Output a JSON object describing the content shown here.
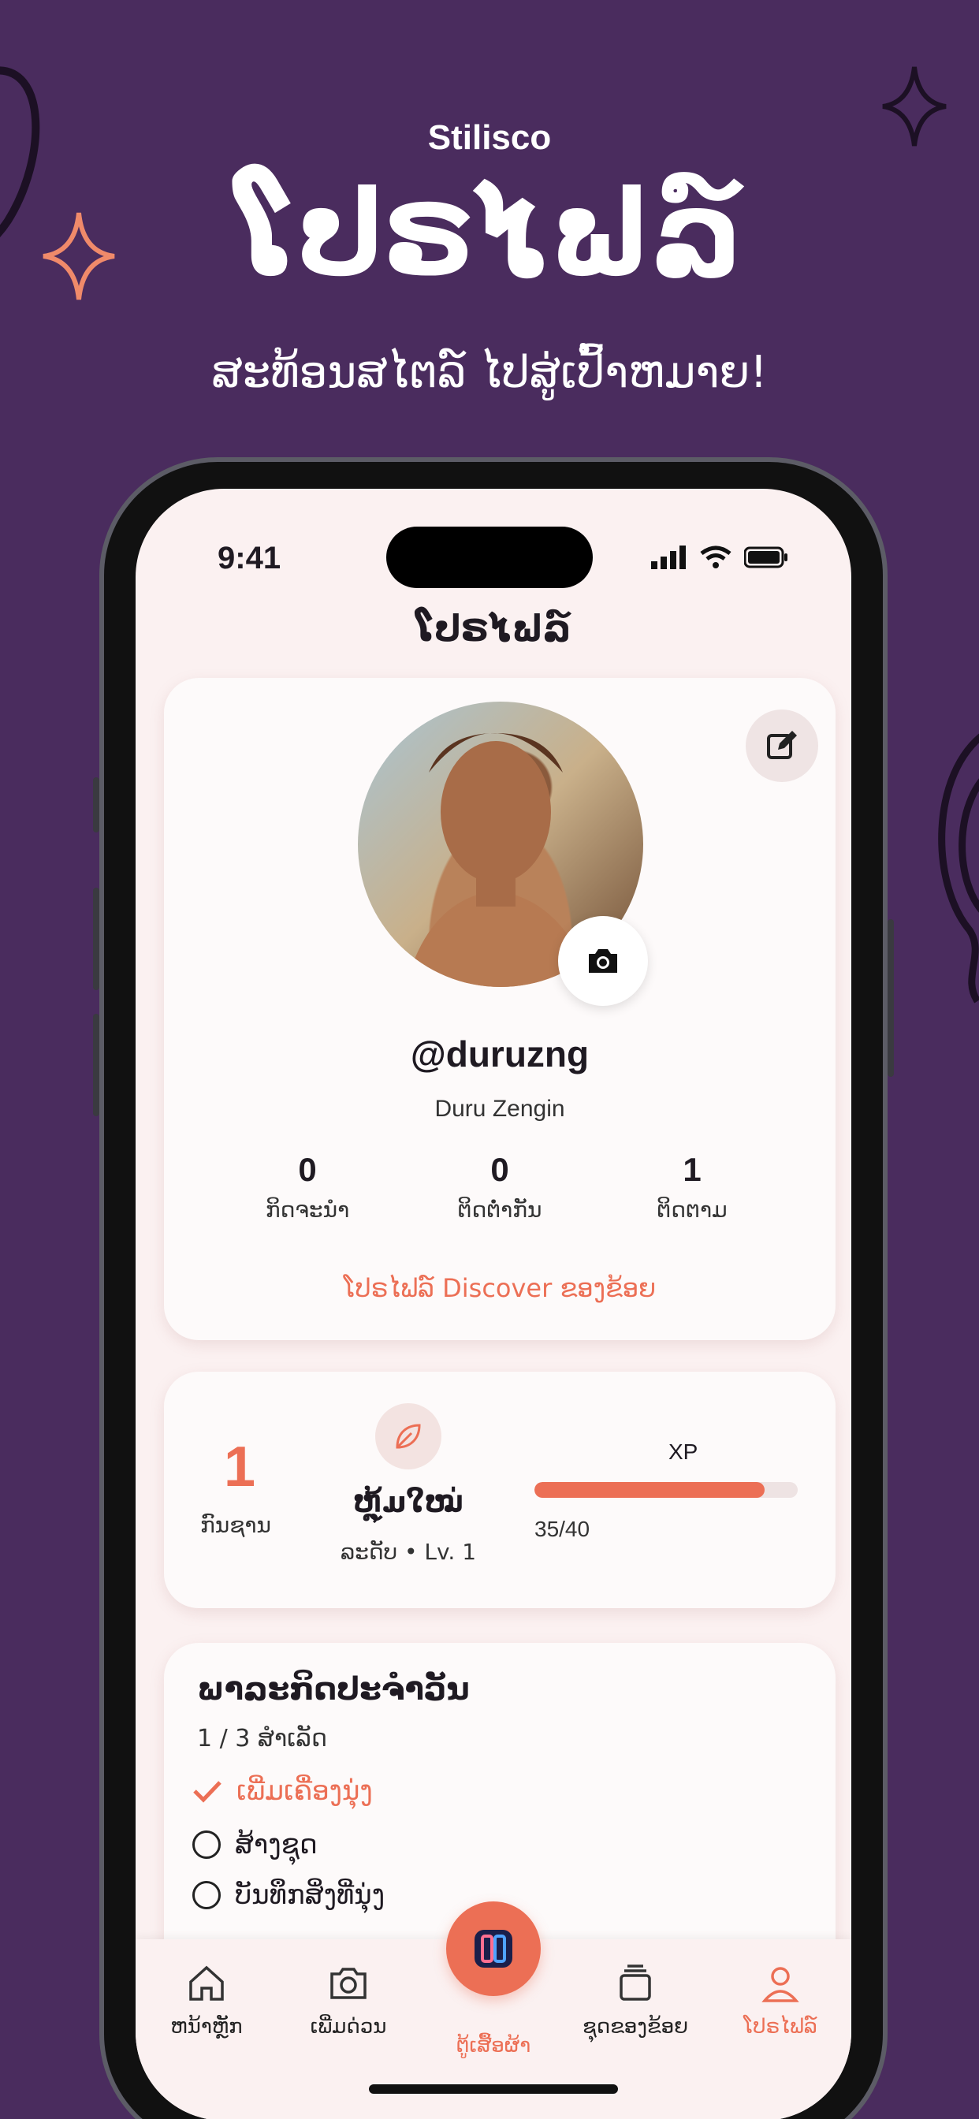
{
  "promo": {
    "brand": "Stilisco",
    "title": "ໂປຣໄຟລ໌",
    "subtitle": "ສະທ້ອນສໄຕລ໌ ໄປສູ່ເປົ້າຫມາຍ!"
  },
  "status_bar": {
    "time": "9:41"
  },
  "header": {
    "title": "ໂປຣໄຟລ໌"
  },
  "profile": {
    "handle": "@duruzng",
    "full_name": "Duru Zengin",
    "stats": [
      {
        "value": "0",
        "label": "ກິດຈະນຳ"
      },
      {
        "value": "0",
        "label": "ຕິດຕໍ່າກັນ"
      },
      {
        "value": "1",
        "label": "ຕິດຕາມ"
      }
    ],
    "discover_link": "ໂປຣໄຟລ໌ Discover ຂອງຂ້ອຍ"
  },
  "level": {
    "number": "1",
    "number_label": "ກົນຊານ",
    "rank_name": "ຫຼຸ້ມໃໝ່",
    "rank_sub": "ລະດັບ • Lv. 1",
    "xp_label": "XP",
    "xp_text": "35/40",
    "xp_fraction": 0.875
  },
  "daily_tasks": {
    "title": "ພາລະກິດປະຈຳວັນ",
    "progress": "1 / 3 ສຳເລັດ",
    "items": [
      {
        "label": "ເພີ່ມເຄື່ອງນຸ່ງ",
        "done": true
      },
      {
        "label": "ສ້າງຊຸດ",
        "done": false
      },
      {
        "label": "ບັນທຶກສິ່ງທີ່ນຸ່ງ",
        "done": false
      }
    ]
  },
  "tabbar": {
    "items": [
      {
        "label": "ຫນ້າຫຼັກ",
        "icon": "home-icon"
      },
      {
        "label": "ເພີ່ມດ່ວນ",
        "icon": "camera-icon"
      },
      {
        "label": "ຕູ້ເສື້ອຜ້າ",
        "icon": "wardrobe-icon"
      },
      {
        "label": "ຊຸດຂອງຂ້ອຍ",
        "icon": "outfits-icon"
      },
      {
        "label": "ໂປຣໄຟລ໌",
        "icon": "user-icon"
      }
    ],
    "active_index": 4
  },
  "colors": {
    "accent": "#ec6f55",
    "background": "#4a2c5e",
    "screen": "#fbf1f1"
  }
}
